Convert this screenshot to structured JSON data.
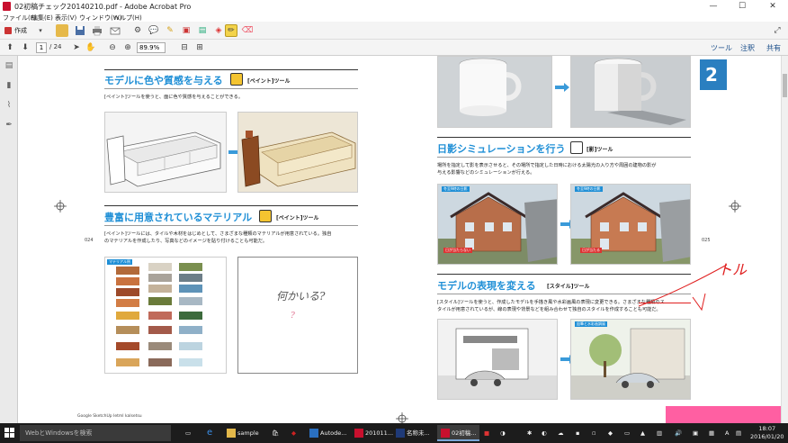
{
  "window": {
    "title": "02初稿チェック20140210.pdf - Adobe Acrobat Pro",
    "minimize": "—",
    "maximize": "☐",
    "close": "✕"
  },
  "menu": [
    "ファイル(F)",
    "編集(E)",
    "表示(V)",
    "ウィンドウ(W)",
    "ヘルプ(H)"
  ],
  "toolbar": {
    "create_label": "作成",
    "page_current": "1",
    "page_total": "/ 24",
    "zoom": "89.9%",
    "tabs": [
      "ツール",
      "注釈",
      "共有"
    ]
  },
  "document": {
    "left_page": {
      "section1_title": "モデルに色や質感を与える",
      "section1_tool": "[ペイント]ツール",
      "section1_text": "[ペイント]ツールを使うと、面に色や質感を与えることができる。",
      "section2_title": "豊富に用意されているマテリアル",
      "section2_tool": "[ペイント]ツール",
      "section2_text_1": "[ペイント]ツールには、タイルや木材をはじめとして、さまざまな種類のマテリアルが用意されている。独自",
      "section2_text_2": "のマテリアルを作成したり、写真などのイメージを貼り付けることも可能だ。",
      "material_label": "マテリアル例",
      "page_number": "024",
      "footer": "Google SketchUp Ietml kaIsetsu"
    },
    "right_page": {
      "chapter_number": "2",
      "section1_title": "日影シミュレーションを行う",
      "section1_tool": "[影]ツール",
      "section1_text_1": "場所を指定して影を表示させると、その場所で指定した日時における太陽光の入り方や周囲の建物の影が",
      "section1_text_2": "与える影響などのシミュレーションが行える。",
      "house_label_1": "冬至9時の日影",
      "house_label_2": "冬至9時の日影",
      "red_label_1": "日が当たらない",
      "red_label_2": "日が当たる",
      "section2_title": "モデルの表現を変える",
      "section2_tool": "[スタイル]ツール",
      "section2_text_1": "[スタイル]ツールを使うと、作成したモデルを手描き風や水彩画風の表現に変更できる。さまざまな種類のス",
      "section2_text_2": "タイルが用意されているが、線の表現や背景などを組み合わせて独自のスタイルを作成することも可能だ。",
      "style_label": "鉛筆と水彩画調風",
      "page_number": "025"
    },
    "annotations": {
      "handwritten_question": "何かいる?",
      "handwritten_question_mark": "?",
      "handwritten_red": "トル"
    }
  },
  "taskbar": {
    "search_placeholder": "WebとWindowsを検索",
    "items": [
      "sample",
      "Autode...",
      "201011...",
      "名称未...",
      "02初稿..."
    ],
    "time": "18:07",
    "date": "2016/01/20",
    "ime": "A"
  },
  "colors": {
    "accent_blue": "#1f8fd6",
    "annotation_red": "#e02020",
    "sticky_note": "#ff5fa2"
  }
}
